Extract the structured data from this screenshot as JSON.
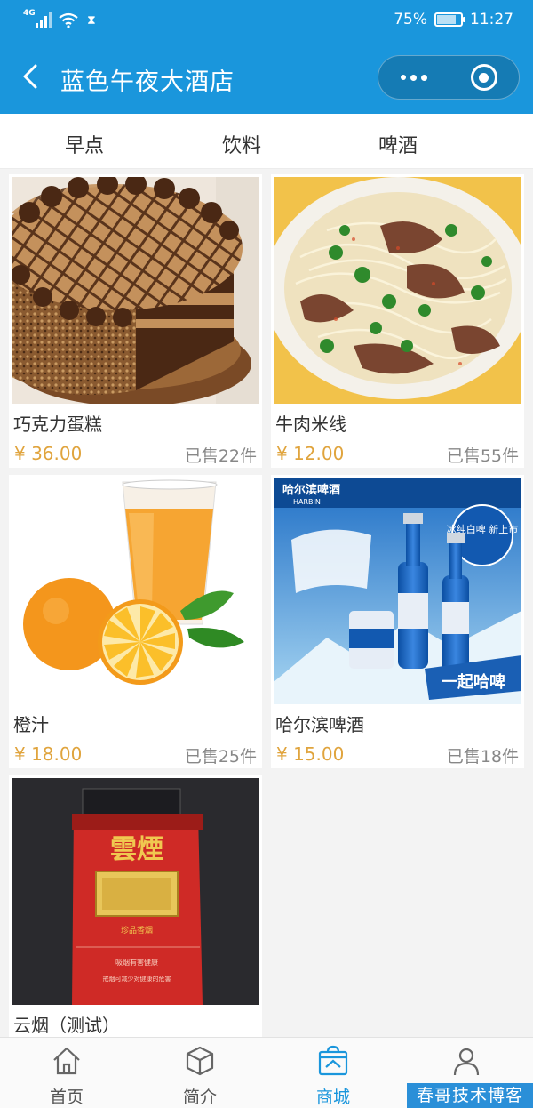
{
  "status_bar": {
    "network": "4G",
    "battery_percent": "75%",
    "battery_level": 0.75,
    "time": "11:27"
  },
  "nav": {
    "title": "蓝色午夜大酒店",
    "back_icon": "chevron-left-icon",
    "more_icon": "more-dots-icon",
    "close_icon": "target-close-icon"
  },
  "theme": {
    "primary": "#1a96dc",
    "price": "#e0a43d"
  },
  "tabs": [
    {
      "label": "早点"
    },
    {
      "label": "饮料"
    },
    {
      "label": "啤酒"
    }
  ],
  "products": [
    {
      "name": "巧克力蛋糕",
      "price": "¥ 36.00",
      "sold": "已售22件",
      "image": "chocolate-cake"
    },
    {
      "name": "牛肉米线",
      "price": "¥ 12.00",
      "sold": "已售55件",
      "image": "beef-rice-noodles"
    },
    {
      "name": "橙汁",
      "price": "¥ 18.00",
      "sold": "已售25件",
      "image": "orange-juice"
    },
    {
      "name": "哈尔滨啤酒",
      "price": "¥ 15.00",
      "sold": "已售18件",
      "image": "harbin-beer"
    },
    {
      "name": "云烟（测试）",
      "image": "yunyan-cigarettes"
    }
  ],
  "beer_ad": {
    "brand": "哈尔滨啤酒",
    "brand_en": "HARBIN",
    "slogan": "一起哈啤",
    "badge": "冰纯白啤 新上市"
  },
  "cigarette": {
    "brand": "雲煙",
    "subline": "珍品香烟",
    "warning1": "吸烟有害健康",
    "warning2": "戒烟可减少对健康的危害"
  },
  "tabbar": [
    {
      "label": "首页",
      "icon": "home-icon"
    },
    {
      "label": "简介",
      "icon": "cube-icon"
    },
    {
      "label": "商城",
      "icon": "shop-bag-icon",
      "active": true
    },
    {
      "label": "",
      "icon": "user-icon"
    }
  ],
  "watermark": "春哥技术博客"
}
